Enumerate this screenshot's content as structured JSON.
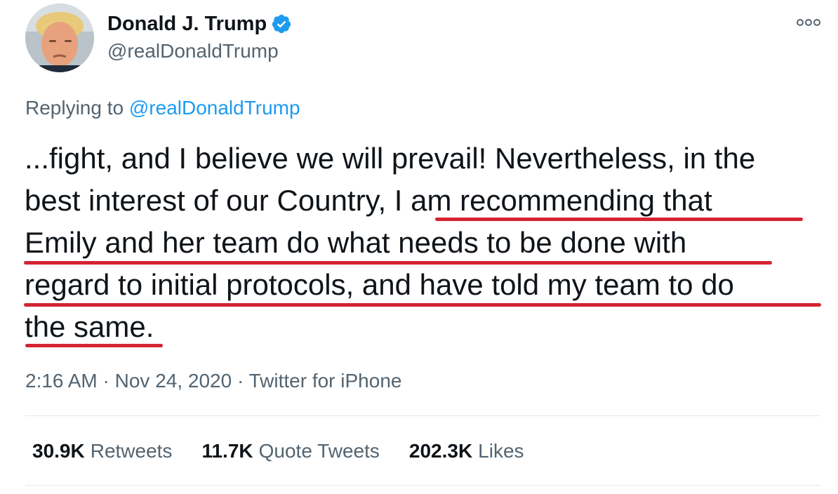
{
  "author": {
    "display_name": "Donald J. Trump",
    "handle": "@realDonaldTrump",
    "verified_icon": "verified-badge-icon"
  },
  "more_icon": "more-options-icon",
  "reply_context": {
    "prefix": "Replying to",
    "mention": "@realDonaldTrump"
  },
  "tweet": {
    "lines": [
      "...fight, and I believe we will prevail! Nevertheless, in the",
      "best interest of our Country, I am recommending that",
      "Emily and her team do what needs to be done with",
      "regard to initial protocols, and have told my team to do",
      "the same."
    ],
    "highlighted_text": "I am recommending that Emily and her team do what needs to be done with regard to initial protocols, and have told my team to do the same.",
    "highlight_color": "#d32432"
  },
  "meta": {
    "time": "2:16 AM",
    "separator": "·",
    "date": "Nov 24, 2020",
    "source": "Twitter for iPhone"
  },
  "stats": [
    {
      "value": "30.9K",
      "label": "Retweets"
    },
    {
      "value": "11.7K",
      "label": "Quote Tweets"
    },
    {
      "value": "202.3K",
      "label": "Likes"
    }
  ],
  "colors": {
    "link": "#1d9bf0",
    "secondary_text": "#536471",
    "primary_text": "#0f1419",
    "divider": "#e3e7ea"
  }
}
